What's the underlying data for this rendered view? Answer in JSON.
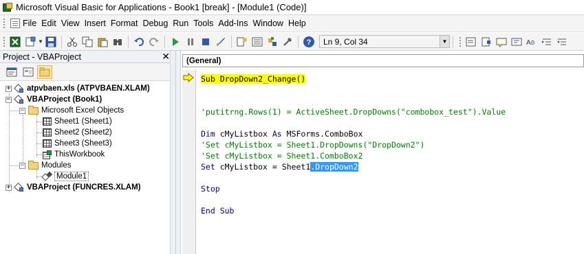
{
  "window": {
    "title": "Microsoft Visual Basic for Applications - Book1 [break] - [Module1 (Code)]"
  },
  "menu": {
    "items": [
      "File",
      "Edit",
      "View",
      "Insert",
      "Format",
      "Debug",
      "Run",
      "Tools",
      "Add-Ins",
      "Window",
      "Help"
    ]
  },
  "toolbar": {
    "position": "Ln 9, Col 34",
    "icons": [
      "excel-icon",
      "insert-module-icon",
      "save-icon",
      "cut-icon",
      "copy-icon",
      "paste-icon",
      "find-icon",
      "undo-icon",
      "redo-icon",
      "run-icon",
      "break-icon",
      "reset-icon",
      "design-mode-icon",
      "project-explorer-icon",
      "properties-icon",
      "object-browser-icon",
      "toolbox-icon",
      "help-icon"
    ]
  },
  "project": {
    "header": "Project - VBAProject",
    "close": "✕",
    "tree": [
      {
        "label": "atpvbaen.xls (ATPVBAEN.XLAM)",
        "bold": true
      },
      {
        "label": "VBAProject (Book1)",
        "bold": true
      },
      {
        "label": "Microsoft Excel Objects",
        "bold": false
      },
      {
        "label": "Sheet1 (Sheet1)",
        "bold": false
      },
      {
        "label": "Sheet2 (Sheet2)",
        "bold": false
      },
      {
        "label": "Sheet3 (Sheet3)",
        "bold": false
      },
      {
        "label": "ThisWorkbook",
        "bold": false
      },
      {
        "label": "Modules",
        "bold": false
      },
      {
        "label": "Module1",
        "bold": false
      },
      {
        "label": "VBAProject (FUNCRES.XLAM)",
        "bold": true
      }
    ]
  },
  "code": {
    "object_combo": "(General)",
    "lines": [
      {
        "parts": [
          {
            "t": "Sub DropDown2_Change()",
            "cls": "exec-line"
          }
        ]
      },
      {
        "parts": []
      },
      {
        "parts": []
      },
      {
        "parts": [
          {
            "t": "'putitrng.Rows(1) = ActiveSheet.DropDowns(\"combobox_test\").Value",
            "cls": "c"
          }
        ]
      },
      {
        "parts": []
      },
      {
        "parts": [
          {
            "t": "Dim",
            "cls": "k"
          },
          {
            "t": " cMyListbox ",
            "cls": ""
          },
          {
            "t": "As",
            "cls": "k"
          },
          {
            "t": " MSForms.ComboBox",
            "cls": ""
          }
        ]
      },
      {
        "parts": [
          {
            "t": "'Set cMyListbox = Sheet1.DropDowns(\"DropDown2\")",
            "cls": "c"
          }
        ]
      },
      {
        "parts": [
          {
            "t": "'Set cMyListbox = Sheet1.ComboBox2",
            "cls": "c"
          }
        ]
      },
      {
        "parts": [
          {
            "t": "Set",
            "cls": "k"
          },
          {
            "t": " cMyListbox = Sheet1",
            "cls": ""
          },
          {
            "t": ".DropDown2",
            "cls": "sel"
          }
        ]
      },
      {
        "parts": []
      },
      {
        "parts": [
          {
            "t": "Stop",
            "cls": "k"
          }
        ]
      },
      {
        "parts": []
      },
      {
        "parts": [
          {
            "t": "End Sub",
            "cls": "k"
          }
        ]
      }
    ]
  }
}
